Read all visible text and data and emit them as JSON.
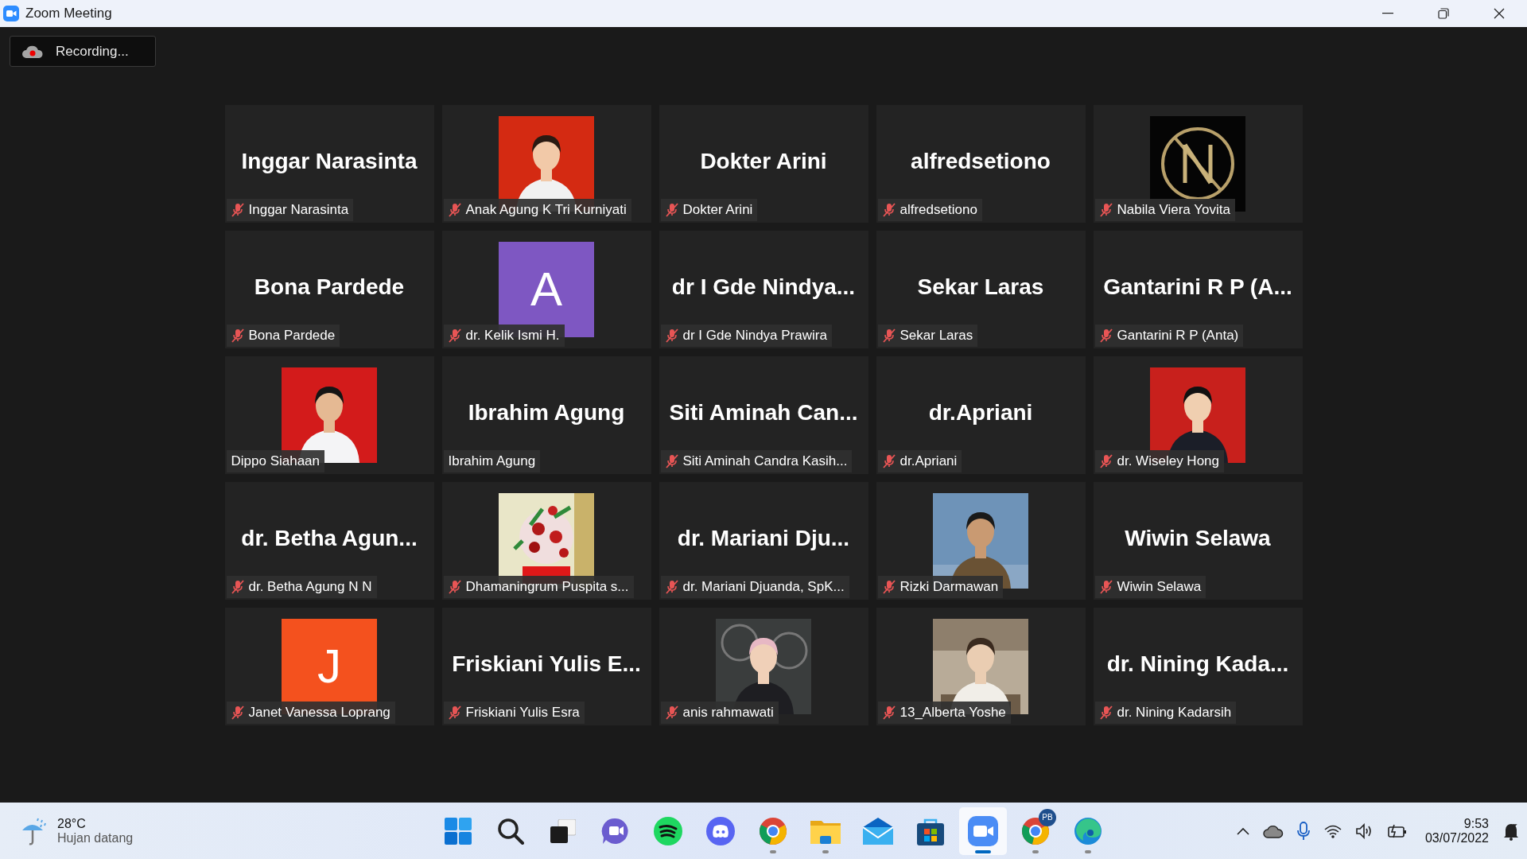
{
  "window": {
    "title": "Zoom Meeting"
  },
  "recording": {
    "label": "Recording..."
  },
  "tiles": [
    {
      "kind": "name",
      "display": "Inggar Narasinta",
      "label": "Inggar Narasinta",
      "muted": true
    },
    {
      "kind": "picture",
      "label": "Anak Agung K Tri Kurniyati",
      "muted": true
    },
    {
      "kind": "name",
      "display": "Dokter Arini",
      "label": "Dokter Arini",
      "muted": true
    },
    {
      "kind": "name",
      "display": "alfredsetiono",
      "label": "alfredsetiono",
      "muted": true
    },
    {
      "kind": "picture",
      "label": "Nabila Viera Yovita",
      "muted": true
    },
    {
      "kind": "name",
      "display": "Bona Pardede",
      "label": "Bona Pardede",
      "muted": true
    },
    {
      "kind": "avatar",
      "letter": "A",
      "color": "#7e57c2",
      "label": "dr. Kelik Ismi H.",
      "muted": true
    },
    {
      "kind": "name",
      "display": "dr I Gde Nindya...",
      "label": "dr I Gde Nindya Prawira",
      "muted": true
    },
    {
      "kind": "name",
      "display": "Sekar Laras",
      "label": "Sekar Laras",
      "muted": true
    },
    {
      "kind": "name",
      "display": "Gantarini R P (A...",
      "label": "Gantarini R P (Anta)",
      "muted": true
    },
    {
      "kind": "picture",
      "label": "Dippo Siahaan",
      "muted": false
    },
    {
      "kind": "name",
      "display": "Ibrahim Agung",
      "label": "Ibrahim Agung",
      "muted": false
    },
    {
      "kind": "name",
      "display": "Siti Aminah Can...",
      "label": "Siti Aminah Candra Kasih...",
      "muted": true
    },
    {
      "kind": "name",
      "display": "dr.Apriani",
      "label": "dr.Apriani",
      "muted": true
    },
    {
      "kind": "picture",
      "label": "dr. Wiseley Hong",
      "muted": true
    },
    {
      "kind": "name",
      "display": "dr. Betha Agun...",
      "label": "dr. Betha Agung N N",
      "muted": true
    },
    {
      "kind": "picture",
      "label": "Dhamaningrum Puspita s...",
      "muted": true
    },
    {
      "kind": "name",
      "display": "dr. Mariani Dju...",
      "label": "dr. Mariani Djuanda, SpK...",
      "muted": true
    },
    {
      "kind": "picture",
      "label": "Rizki Darmawan",
      "muted": true
    },
    {
      "kind": "name",
      "display": "Wiwin Selawa",
      "label": "Wiwin Selawa",
      "muted": true
    },
    {
      "kind": "avatar",
      "letter": "J",
      "color": "#f4511e",
      "label": "Janet Vanessa Loprang",
      "muted": true
    },
    {
      "kind": "name",
      "display": "Friskiani Yulis E...",
      "label": "Friskiani Yulis Esra",
      "muted": true
    },
    {
      "kind": "picture",
      "label": "anis rahmawati",
      "muted": true
    },
    {
      "kind": "picture",
      "label": "13_Alberta Yoshe",
      "muted": true
    },
    {
      "kind": "name",
      "display": "dr. Nining Kada...",
      "label": "dr. Nining Kadarsih",
      "muted": true
    }
  ],
  "taskbar": {
    "weather": {
      "temp": "28°C",
      "condition": "Hujan datang"
    },
    "apps": [
      {
        "kind": "start",
        "running": false,
        "active": false
      },
      {
        "kind": "search",
        "running": false,
        "active": false
      },
      {
        "kind": "taskview",
        "running": false,
        "active": false
      },
      {
        "kind": "chat",
        "running": false,
        "active": false
      },
      {
        "kind": "music",
        "running": false,
        "active": false
      },
      {
        "kind": "discord",
        "running": false,
        "active": false
      },
      {
        "kind": "browser",
        "running": true,
        "active": false
      },
      {
        "kind": "folder",
        "running": true,
        "active": false
      },
      {
        "kind": "mail",
        "running": false,
        "active": false
      },
      {
        "kind": "store",
        "running": false,
        "active": false
      },
      {
        "kind": "video",
        "running": true,
        "active": true
      },
      {
        "kind": "browser",
        "running": true,
        "active": false,
        "badge": "PB"
      },
      {
        "kind": "edge",
        "running": true,
        "active": false
      }
    ],
    "tray": [
      {
        "kind": "chevron"
      },
      {
        "kind": "cloud"
      },
      {
        "kind": "mic"
      },
      {
        "kind": "wifi"
      },
      {
        "kind": "speaker"
      },
      {
        "kind": "battery"
      }
    ],
    "time": "9:53",
    "date": "03/07/2022"
  }
}
